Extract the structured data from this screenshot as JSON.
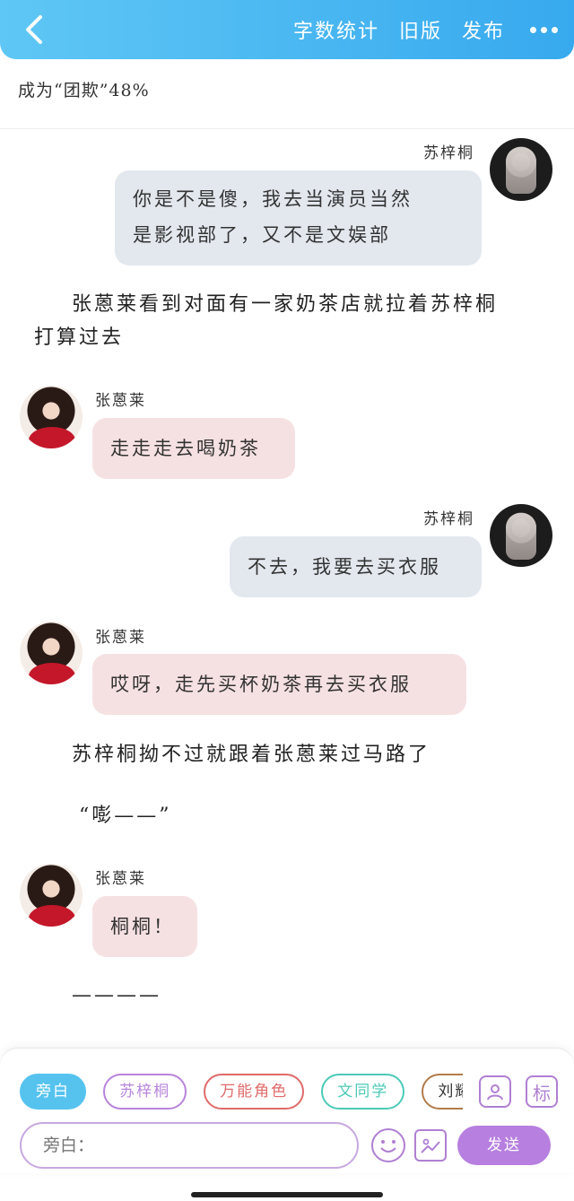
{
  "header": {
    "word_count": "字数统计",
    "old_version": "旧版",
    "publish": "发布"
  },
  "progress": "成为“团欺”48%",
  "chat": [
    {
      "speaker": "苏梓桐",
      "text_lines": [
        "你是不是傻，我去当演员当然",
        "是影视部了，又不是文娱部"
      ]
    },
    {
      "narration": [
        "张蒽莱看到对面有一家奶茶店就拉着苏梓桐",
        "打算过去"
      ]
    },
    {
      "speaker": "张蒽莱",
      "text": "走走走去喝奶茶"
    },
    {
      "speaker": "苏梓桐",
      "text": "不去，我要去买衣服"
    },
    {
      "speaker": "张蒽莱",
      "text": "哎呀，走先买杯奶茶再去买衣服"
    },
    {
      "narration_single": "苏梓桐拗不过就跟着张蒽莱过马路了"
    },
    {
      "narration_quote": "“嘭——”"
    },
    {
      "speaker": "张蒽莱",
      "text": "桐桐！"
    },
    {
      "narration_dash": "————"
    }
  ],
  "roles": {
    "narrator": "旁白",
    "su": "苏梓桐",
    "universal": "万能角色",
    "classmate": "文同学",
    "liu": "刘耀文"
  },
  "input": {
    "placeholder": "旁白："
  },
  "icons": {
    "tag_label": "标"
  },
  "send": "发送",
  "colors": {
    "header": "#37a9ee",
    "accent": "#b77fe0"
  }
}
